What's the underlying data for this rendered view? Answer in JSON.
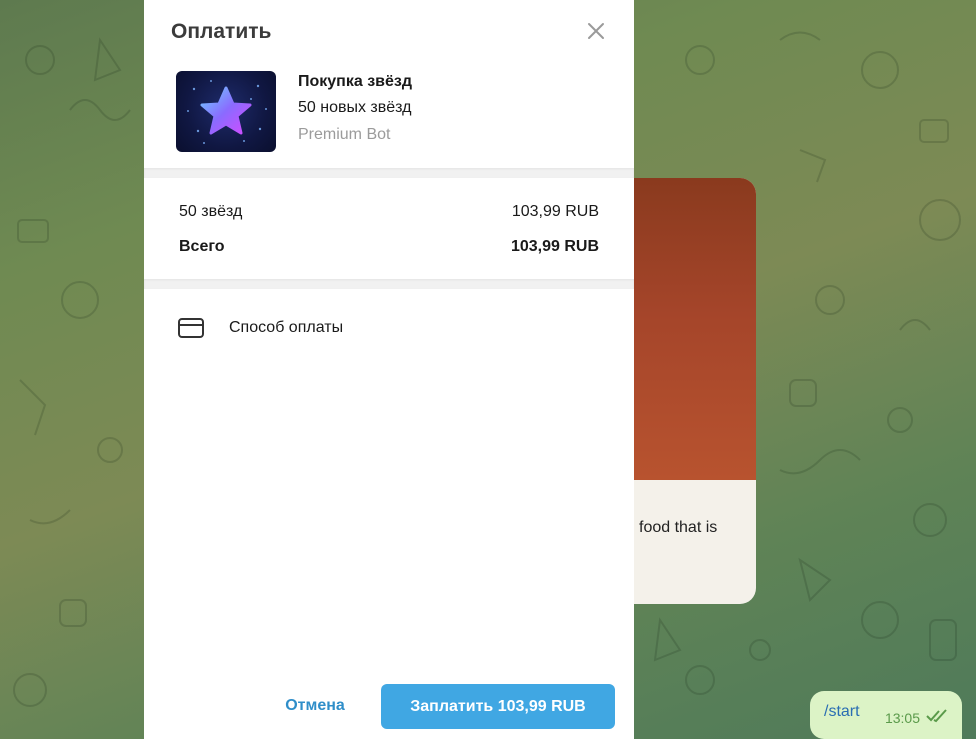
{
  "modal": {
    "title": "Оплатить",
    "product": {
      "title": "Покупка звёзд",
      "description": "50 новых звёзд",
      "bot_name": "Premium Bot"
    },
    "line_items": [
      {
        "label": "50 звёзд",
        "amount": "103,99 RUB"
      }
    ],
    "total": {
      "label": "Всего",
      "amount": "103,99 RUB"
    },
    "payment_method_label": "Способ оплаты",
    "cancel_label": "Отмена",
    "pay_label": "Заплатить 103,99 RUB"
  },
  "chat": {
    "message_snippet": "food that is",
    "outgoing": {
      "text": "/start",
      "time": "13:05"
    }
  },
  "colors": {
    "accent": "#40a7e3",
    "link": "#2f8ec9",
    "muted": "#9b9b9b"
  },
  "icons": [
    "close-icon",
    "star-icon",
    "credit-card-icon",
    "double-check-icon"
  ]
}
